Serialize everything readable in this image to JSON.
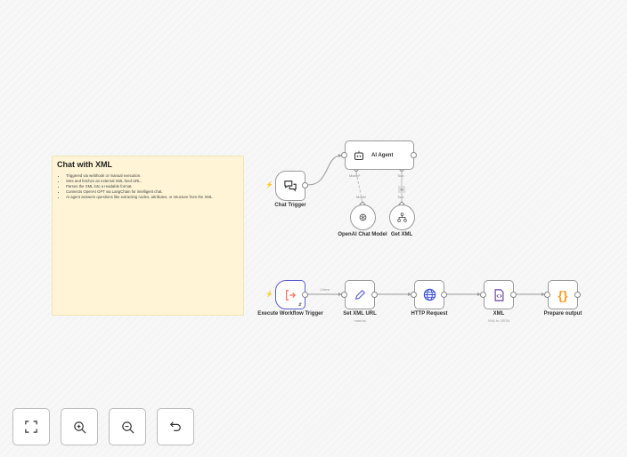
{
  "sticky": {
    "title": "Chat with XML",
    "items": [
      "Triggered via webhook or manual execution.",
      "Sets and fetches an external XML feed URL.",
      "Parses the XML into a readable format.",
      "Connects OpenAI GPT via LangChain for intelligent chat.",
      "AI agent answers questions like extracting nodes, attributes, or structure from the XML."
    ]
  },
  "nodes": {
    "chat_trigger": {
      "label": "Chat Trigger"
    },
    "ai_agent": {
      "label": "AI Agent",
      "model_port": "Model*",
      "tool_port": "Tool"
    },
    "openai": {
      "label": "OpenAI Chat Model",
      "port": "Model"
    },
    "get_xml": {
      "label": "Get XML",
      "port": "Tool"
    },
    "exec_trigger": {
      "label": "Execute Workflow Trigger"
    },
    "set_url": {
      "label": "Set XML URL",
      "sub": "manual"
    },
    "http": {
      "label": "HTTP Request"
    },
    "xml": {
      "label": "XML",
      "sub": "XML to JSON"
    },
    "prepare": {
      "label": "Prepare output"
    }
  },
  "edges": {
    "exec_to_set": "1 item"
  },
  "colors": {
    "trigger": "#ff6d5a",
    "accent": "#5b5bd6",
    "http": "#3b4ed8",
    "xml": "#6b3fa0",
    "code": "#ff9922"
  },
  "controls": [
    "fit-view",
    "zoom-in",
    "zoom-out",
    "undo"
  ]
}
